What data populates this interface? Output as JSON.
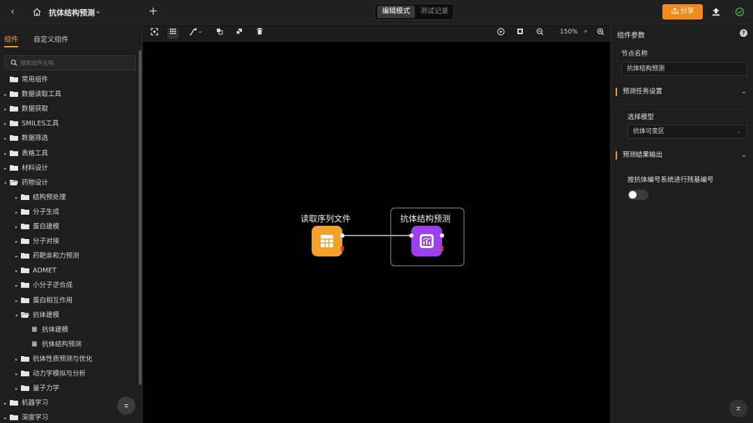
{
  "topbar": {
    "title": "抗体结构预测",
    "modes": {
      "edit": "编辑模式",
      "test": "测试记录"
    },
    "share_label": "分享",
    "icons": [
      "back-icon",
      "home-icon",
      "chevron-down-icon",
      "plus-icon",
      "share-icon",
      "publish-icon",
      "status-check-icon"
    ]
  },
  "left_panel": {
    "tabs": [
      "组件",
      "自定义组件"
    ],
    "search_placeholder": "搜索组件名称",
    "tree": [
      {
        "label": "常用组件",
        "level": 0,
        "expandable": false,
        "icon": "folder"
      },
      {
        "label": "数据读取工具",
        "level": 0,
        "expandable": true,
        "icon": "folder"
      },
      {
        "label": "数据获取",
        "level": 0,
        "expandable": true,
        "icon": "folder"
      },
      {
        "label": "SMILES工具",
        "level": 0,
        "expandable": true,
        "icon": "folder"
      },
      {
        "label": "数据筛选",
        "level": 0,
        "expandable": true,
        "icon": "folder"
      },
      {
        "label": "表格工具",
        "level": 0,
        "expandable": true,
        "icon": "folder"
      },
      {
        "label": "材料设计",
        "level": 0,
        "expandable": true,
        "icon": "folder"
      },
      {
        "label": "药物设计",
        "level": 0,
        "expandable": true,
        "expanded": true,
        "icon": "folder-open"
      },
      {
        "label": "结构预处理",
        "level": 1,
        "expandable": true,
        "icon": "folder"
      },
      {
        "label": "分子生成",
        "level": 1,
        "expandable": true,
        "icon": "folder"
      },
      {
        "label": "蛋白建模",
        "level": 1,
        "expandable": true,
        "icon": "folder"
      },
      {
        "label": "分子对接",
        "level": 1,
        "expandable": true,
        "icon": "folder"
      },
      {
        "label": "药靶亲和力预测",
        "level": 1,
        "expandable": true,
        "icon": "folder"
      },
      {
        "label": "ADMET",
        "level": 1,
        "expandable": true,
        "icon": "folder"
      },
      {
        "label": "小分子逆合成",
        "level": 1,
        "expandable": true,
        "icon": "folder"
      },
      {
        "label": "蛋白相互作用",
        "level": 1,
        "expandable": true,
        "icon": "folder"
      },
      {
        "label": "抗体建模",
        "level": 1,
        "expandable": true,
        "expanded": true,
        "icon": "folder-open"
      },
      {
        "label": "抗体建模",
        "level": 2,
        "expandable": false,
        "icon": "component"
      },
      {
        "label": "抗体结构预测",
        "level": 2,
        "expandable": false,
        "icon": "component"
      },
      {
        "label": "抗体性质预测与优化",
        "level": 1,
        "expandable": true,
        "icon": "folder"
      },
      {
        "label": "动力学模拟与分析",
        "level": 1,
        "expandable": true,
        "icon": "folder"
      },
      {
        "label": "量子力学",
        "level": 1,
        "expandable": true,
        "icon": "folder"
      },
      {
        "label": "机器学习",
        "level": 0,
        "expandable": true,
        "icon": "folder"
      },
      {
        "label": "深度学习",
        "level": 0,
        "expandable": true,
        "icon": "folder"
      }
    ]
  },
  "canvas": {
    "zoom": "150%",
    "nodes": [
      {
        "id": "read",
        "label": "读取序列文件",
        "color": "#f5a02a",
        "icon": "table-icon"
      },
      {
        "id": "predict",
        "label": "抗体结构预测",
        "color": "#9b3ff0",
        "icon": "chart-icon",
        "selected": true
      }
    ],
    "edges": [
      {
        "from": "read",
        "to": "predict"
      }
    ]
  },
  "right_panel": {
    "title": "组件参数",
    "node_name_label": "节点名称",
    "node_name_value": "抗体结构预测",
    "section_task": "预测任务设置",
    "model_label": "选择模型",
    "model_value": "抗体可变区",
    "section_output": "预测结果输出",
    "numbering_label": "按抗体编号系统进行残基编号",
    "numbering_enabled": false
  },
  "colors": {
    "accent": "#f39b2e",
    "share": "#f08a1c",
    "status_ok": "#3cc05a"
  }
}
